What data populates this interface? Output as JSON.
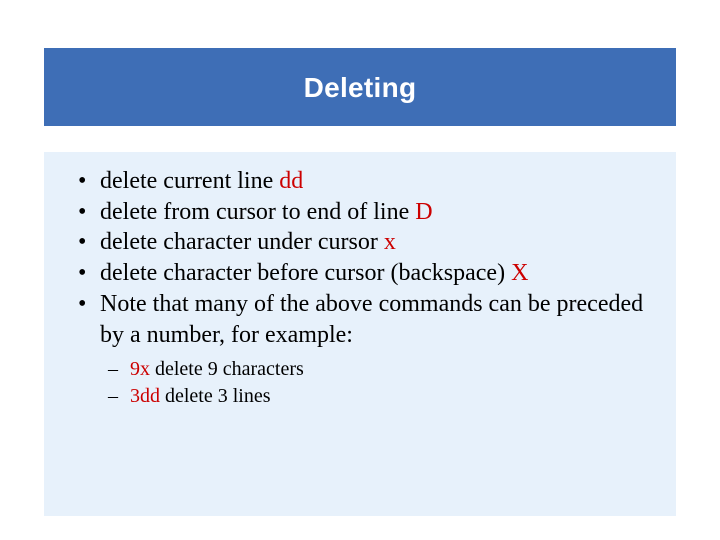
{
  "title": "Deleting",
  "bullets": [
    {
      "text": "delete current line ",
      "cmd": "dd"
    },
    {
      "text": "delete from cursor to end of line ",
      "cmd": "D"
    },
    {
      "text": "delete character under cursor ",
      "cmd": "x"
    },
    {
      "text": "delete character before cursor (backspace) ",
      "cmd": "X"
    },
    {
      "text": "Note that many of the above commands can be preceded by a number, for example:",
      "cmd": ""
    }
  ],
  "subbullets": [
    {
      "cmd": "9x",
      "rest": " delete 9 characters"
    },
    {
      "cmd": "3dd",
      "rest": " delete 3 lines"
    }
  ]
}
